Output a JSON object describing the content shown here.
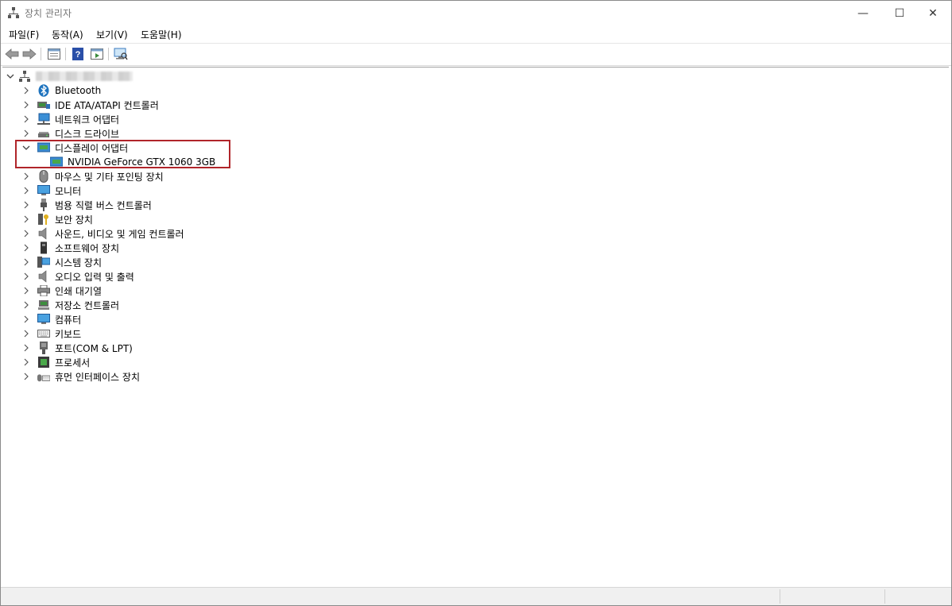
{
  "window": {
    "title": "장치 관리자",
    "minimize": "—",
    "maximize": "☐",
    "close": "✕"
  },
  "menu": [
    {
      "label": "파일(F)"
    },
    {
      "label": "동작(A)"
    },
    {
      "label": "보기(V)"
    },
    {
      "label": "도움말(H)"
    }
  ],
  "toolbar": {
    "back": "back-arrow-icon",
    "forward": "forward-arrow-icon",
    "properties": "properties-icon",
    "help": "help-icon",
    "update_driver": "update-driver-icon",
    "scan_hardware": "scan-hardware-icon"
  },
  "tree": {
    "root_label": "",
    "items": [
      {
        "label": "Bluetooth",
        "icon": "bluetooth-icon"
      },
      {
        "label": "IDE ATA/ATAPI 컨트롤러",
        "icon": "ide-controller-icon"
      },
      {
        "label": "네트워크 어댑터",
        "icon": "network-adapter-icon"
      },
      {
        "label": "디스크 드라이브",
        "icon": "disk-drive-icon"
      },
      {
        "label": "디스플레이 어댑터",
        "icon": "display-adapter-icon",
        "expanded": true,
        "children": [
          {
            "label": "NVIDIA GeForce GTX 1060 3GB",
            "icon": "gpu-icon"
          }
        ]
      },
      {
        "label": "마우스 및 기타 포인팅 장치",
        "icon": "mouse-icon"
      },
      {
        "label": "모니터",
        "icon": "monitor-icon"
      },
      {
        "label": "범용 직렬 버스 컨트롤러",
        "icon": "usb-icon"
      },
      {
        "label": "보안 장치",
        "icon": "security-key-icon"
      },
      {
        "label": "사운드, 비디오 및 게임 컨트롤러",
        "icon": "speaker-icon"
      },
      {
        "label": "소프트웨어 장치",
        "icon": "software-device-icon"
      },
      {
        "label": "시스템 장치",
        "icon": "system-device-icon"
      },
      {
        "label": "오디오 입력 및 출력",
        "icon": "audio-io-icon"
      },
      {
        "label": "인쇄 대기열",
        "icon": "printer-icon"
      },
      {
        "label": "저장소 컨트롤러",
        "icon": "storage-controller-icon"
      },
      {
        "label": "컴퓨터",
        "icon": "computer-icon"
      },
      {
        "label": "키보드",
        "icon": "keyboard-icon"
      },
      {
        "label": "포트(COM & LPT)",
        "icon": "port-icon"
      },
      {
        "label": "프로세서",
        "icon": "processor-icon"
      },
      {
        "label": "휴먼 인터페이스 장치",
        "icon": "hid-icon"
      }
    ]
  },
  "colors": {
    "highlight": "#b0252a",
    "accent": "#1e73be"
  }
}
